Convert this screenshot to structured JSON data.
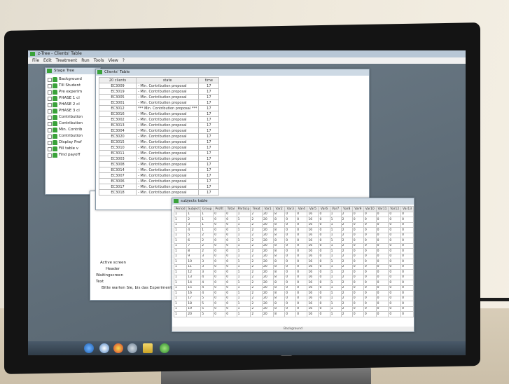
{
  "app": {
    "title": "z-Tree - Clients' Table",
    "menu": [
      "File",
      "Edit",
      "Treatment",
      "Run",
      "Tools",
      "View",
      "?"
    ]
  },
  "stage_tree": {
    "title": "Stage Tree",
    "items": [
      "Background",
      "Till Student",
      "Pre experim",
      "PHASE 1 cl",
      "PHASE 2 cl",
      "PHASE 3 cl",
      "Contribution",
      "Contribution",
      "Min. Contrib",
      "Contribution",
      "Display Prof",
      "Fill table v",
      "Find payoff"
    ]
  },
  "clients_table": {
    "title": "Clients' Table",
    "headers": [
      "20 clients",
      "state",
      "time"
    ],
    "rows": [
      [
        "EC3009",
        "- Min. Contribution proposal",
        "17"
      ],
      [
        "EC3019",
        "- Min. Contribution proposal",
        "17"
      ],
      [
        "EC3005",
        "- Min. Contribution proposal",
        "17"
      ],
      [
        "EC3001",
        "- Min. Contribution proposal",
        "17"
      ],
      [
        "EC3012",
        "*** Min. Contribution proposal ***",
        "17"
      ],
      [
        "EC3016",
        "- Min. Contribution proposal",
        "17"
      ],
      [
        "EC3002",
        "- Min. Contribution proposal",
        "17"
      ],
      [
        "EC3013",
        "- Min. Contribution proposal",
        "17"
      ],
      [
        "EC3004",
        "- Min. Contribution proposal",
        "17"
      ],
      [
        "EC3020",
        "- Min. Contribution proposal",
        "17"
      ],
      [
        "EC3015",
        "- Min. Contribution proposal",
        "17"
      ],
      [
        "EC3010",
        "- Min. Contribution proposal",
        "17"
      ],
      [
        "EC3011",
        "- Min. Contribution proposal",
        "17"
      ],
      [
        "EC3003",
        "- Min. Contribution proposal",
        "17"
      ],
      [
        "EC3008",
        "- Min. Contribution proposal",
        "17"
      ],
      [
        "EC3014",
        "- Min. Contribution proposal",
        "17"
      ],
      [
        "EC3007",
        "- Min. Contribution proposal",
        "17"
      ],
      [
        "EC3006",
        "- Min. Contribution proposal",
        "17"
      ],
      [
        "EC3017",
        "- Min. Contribution proposal",
        "17"
      ],
      [
        "EC3018",
        "- Min. Contribution proposal",
        "17"
      ]
    ]
  },
  "subjects_tree": {
    "items": [
      "Active screen",
      "Header",
      "Waitingscreen",
      "Text",
      "Bitte warten Sie, bis das Experiment"
    ]
  },
  "subjects_table": {
    "title": "subjects table",
    "headers": [
      "Period",
      "Subject",
      "Group",
      "Profit",
      "Total",
      "Particip",
      "Treat",
      "Var1",
      "Var2",
      "Var3",
      "Var4",
      "Var5",
      "Var6",
      "Var7",
      "Var8",
      "Var9",
      "Var10",
      "Var11",
      "Var12",
      "Var13"
    ],
    "rows": [
      [
        "1",
        "1",
        "1",
        "0",
        "0",
        "1",
        "2",
        "20",
        "8",
        "0",
        "0",
        "16",
        "0",
        "1",
        "2",
        "0",
        "0",
        "0",
        "0",
        "0"
      ],
      [
        "1",
        "2",
        "1",
        "0",
        "0",
        "1",
        "2",
        "20",
        "8",
        "0",
        "0",
        "16",
        "0",
        "1",
        "2",
        "0",
        "0",
        "0",
        "0",
        "0"
      ],
      [
        "1",
        "3",
        "1",
        "0",
        "0",
        "1",
        "2",
        "20",
        "8",
        "0",
        "0",
        "16",
        "0",
        "1",
        "2",
        "0",
        "0",
        "0",
        "0",
        "0"
      ],
      [
        "1",
        "4",
        "1",
        "0",
        "0",
        "1",
        "2",
        "20",
        "8",
        "0",
        "0",
        "16",
        "0",
        "1",
        "2",
        "0",
        "0",
        "0",
        "0",
        "0"
      ],
      [
        "1",
        "5",
        "2",
        "0",
        "0",
        "1",
        "2",
        "20",
        "8",
        "0",
        "0",
        "16",
        "0",
        "1",
        "2",
        "0",
        "0",
        "0",
        "0",
        "0"
      ],
      [
        "1",
        "6",
        "2",
        "0",
        "0",
        "1",
        "2",
        "20",
        "8",
        "0",
        "0",
        "16",
        "0",
        "1",
        "2",
        "0",
        "0",
        "0",
        "0",
        "0"
      ],
      [
        "1",
        "7",
        "2",
        "0",
        "0",
        "1",
        "2",
        "20",
        "8",
        "0",
        "0",
        "16",
        "0",
        "1",
        "2",
        "0",
        "0",
        "0",
        "0",
        "0"
      ],
      [
        "1",
        "8",
        "2",
        "0",
        "0",
        "1",
        "2",
        "20",
        "8",
        "0",
        "0",
        "16",
        "0",
        "1",
        "2",
        "0",
        "0",
        "0",
        "0",
        "0"
      ],
      [
        "1",
        "9",
        "3",
        "0",
        "0",
        "1",
        "2",
        "20",
        "8",
        "0",
        "0",
        "16",
        "0",
        "1",
        "2",
        "0",
        "0",
        "0",
        "0",
        "0"
      ],
      [
        "1",
        "10",
        "3",
        "0",
        "0",
        "1",
        "2",
        "20",
        "8",
        "0",
        "0",
        "16",
        "0",
        "1",
        "2",
        "0",
        "0",
        "0",
        "0",
        "0"
      ],
      [
        "1",
        "11",
        "3",
        "0",
        "0",
        "1",
        "2",
        "20",
        "8",
        "0",
        "0",
        "16",
        "0",
        "1",
        "2",
        "0",
        "0",
        "0",
        "0",
        "0"
      ],
      [
        "1",
        "12",
        "3",
        "0",
        "0",
        "1",
        "2",
        "20",
        "8",
        "0",
        "0",
        "16",
        "0",
        "1",
        "2",
        "0",
        "0",
        "0",
        "0",
        "0"
      ],
      [
        "1",
        "13",
        "4",
        "0",
        "0",
        "1",
        "2",
        "20",
        "8",
        "0",
        "0",
        "16",
        "0",
        "1",
        "2",
        "0",
        "0",
        "0",
        "0",
        "0"
      ],
      [
        "1",
        "14",
        "4",
        "0",
        "0",
        "1",
        "2",
        "20",
        "8",
        "0",
        "0",
        "16",
        "0",
        "1",
        "2",
        "0",
        "0",
        "0",
        "0",
        "0"
      ],
      [
        "1",
        "15",
        "4",
        "0",
        "0",
        "1",
        "2",
        "20",
        "8",
        "0",
        "0",
        "16",
        "0",
        "1",
        "2",
        "0",
        "0",
        "0",
        "0",
        "0"
      ],
      [
        "1",
        "16",
        "4",
        "0",
        "0",
        "1",
        "2",
        "20",
        "8",
        "0",
        "0",
        "16",
        "0",
        "1",
        "2",
        "0",
        "0",
        "0",
        "0",
        "0"
      ],
      [
        "1",
        "17",
        "5",
        "0",
        "0",
        "1",
        "2",
        "20",
        "8",
        "0",
        "0",
        "16",
        "0",
        "1",
        "2",
        "0",
        "0",
        "0",
        "0",
        "0"
      ],
      [
        "1",
        "18",
        "5",
        "0",
        "0",
        "1",
        "2",
        "20",
        "8",
        "0",
        "0",
        "16",
        "0",
        "1",
        "2",
        "0",
        "0",
        "0",
        "0",
        "0"
      ],
      [
        "1",
        "19",
        "5",
        "0",
        "0",
        "1",
        "2",
        "20",
        "8",
        "0",
        "0",
        "16",
        "0",
        "1",
        "2",
        "0",
        "0",
        "0",
        "0",
        "0"
      ],
      [
        "1",
        "20",
        "5",
        "0",
        "0",
        "1",
        "2",
        "20",
        "8",
        "0",
        "0",
        "16",
        "0",
        "1",
        "2",
        "0",
        "0",
        "0",
        "0",
        "0"
      ]
    ],
    "status": "Background"
  },
  "colors": {
    "desktop": "#5e6c77",
    "accent_green": "#3aa23a",
    "taskbar": "#2f3c48"
  }
}
